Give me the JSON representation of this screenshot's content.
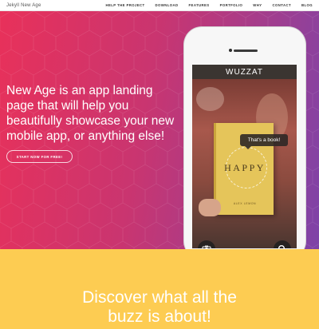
{
  "navbar": {
    "brand": "Jekyll New Age",
    "links": [
      "HELP THE PROJECT",
      "DOWNLOAD",
      "FEATURES",
      "PORTFOLIO",
      "WHY",
      "CONTACT",
      "BLOG"
    ]
  },
  "hero": {
    "heading": "New Age is an app landing page that will help you beautifully showcase your new mobile app, or anything else!",
    "cta_label": "START NOW FOR FREE!"
  },
  "phone": {
    "app_title": "WUZZAT",
    "bubble_text": "That's a book!",
    "book_title": "HAPPY",
    "book_author": "Alex Lemon",
    "camera_icon": "camera-icon",
    "search_icon": "search-icon"
  },
  "download": {
    "heading_line1": "Discover what all the",
    "heading_line2": "buzz is about!"
  },
  "colors": {
    "gradient_start": "#e8315a",
    "gradient_end": "#7d43a8",
    "download_bg": "#fdcc52"
  }
}
